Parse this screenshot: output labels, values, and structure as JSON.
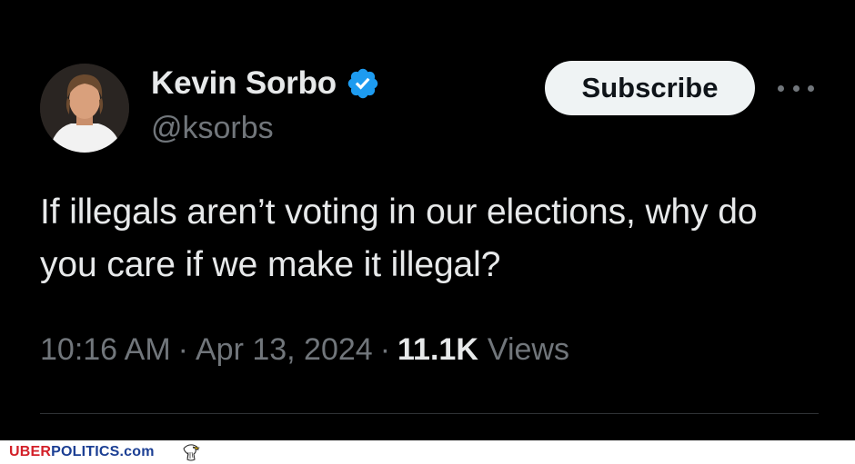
{
  "tweet": {
    "author": {
      "display_name": "Kevin Sorbo",
      "handle": "@ksorbs",
      "verified": true,
      "avatar": "profile-photo"
    },
    "subscribe_label": "Subscribe",
    "more_icon": "ellipsis-icon",
    "text": "If illegals aren’t voting in our elections, why do you care if we make it illegal?",
    "time": "10:16 AM",
    "separator": "·",
    "date": "Apr 13, 2024",
    "views_count": "11.1K",
    "views_label": "Views"
  },
  "footer": {
    "brand_part1": "UBER",
    "brand_part2": "POLITICS.com",
    "brand_icon": "eagle-icon"
  },
  "colors": {
    "background": "#000000",
    "text_primary": "#e7e9ea",
    "text_secondary": "#71767b",
    "verified_blue": "#1d9bf0",
    "button_bg": "#eff3f4",
    "brand_red": "#d32029",
    "brand_blue": "#1c3f94"
  }
}
